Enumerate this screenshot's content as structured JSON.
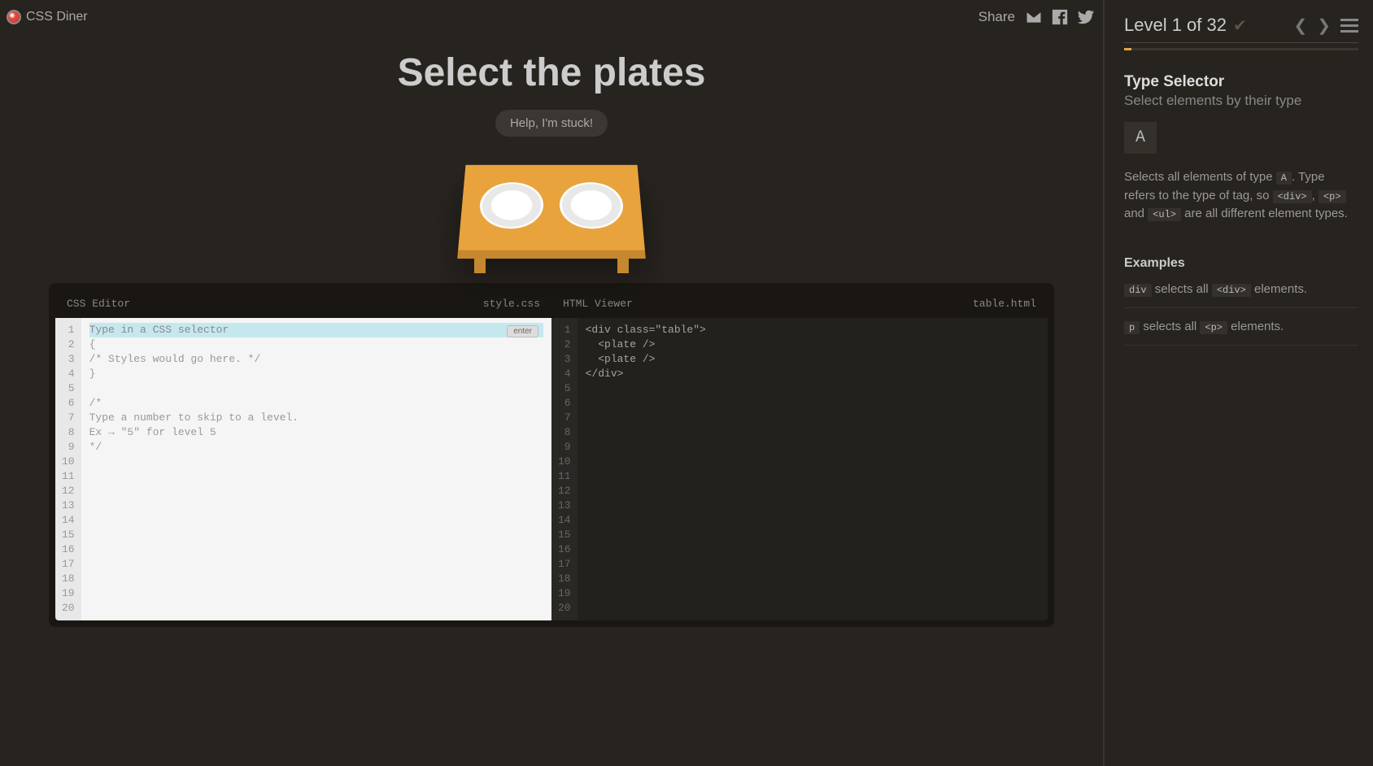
{
  "header": {
    "app_name": "CSS Diner",
    "share_label": "Share"
  },
  "title": "Select the plates",
  "help_button": "Help, I'm stuck!",
  "css_editor": {
    "title": "CSS Editor",
    "filename": "style.css",
    "placeholder": "Type in a CSS selector",
    "enter_label": "enter",
    "lines": [
      "{",
      "/* Styles would go here. */",
      "}",
      "",
      "/*",
      "Type a number to skip to a level.",
      "Ex → \"5\" for level 5",
      "*/"
    ]
  },
  "html_viewer": {
    "title": "HTML Viewer",
    "filename": "table.html",
    "lines": [
      "<div class=\"table\">",
      "  <plate />",
      "  <plate />",
      "</div>"
    ]
  },
  "line_numbers": [
    1,
    2,
    3,
    4,
    5,
    6,
    7,
    8,
    9,
    10,
    11,
    12,
    13,
    14,
    15,
    16,
    17,
    18,
    19,
    20
  ],
  "sidebar": {
    "level_label": "Level 1 of 32",
    "selector_name": "Type Selector",
    "selector_sub": "Select elements by their type",
    "syntax": "A",
    "desc_1": "Selects all elements of type ",
    "desc_chip_1": "A",
    "desc_2": ". Type refers to the type of tag, so ",
    "desc_chip_2": "<div>",
    "desc_3": ", ",
    "desc_chip_3": "<p>",
    "desc_4": " and ",
    "desc_chip_4": "<ul>",
    "desc_5": " are all different element types.",
    "examples_title": "Examples",
    "ex1_chip1": "div",
    "ex1_text": " selects all ",
    "ex1_chip2": "<div>",
    "ex1_tail": " elements.",
    "ex2_chip1": "p",
    "ex2_text": " selects all ",
    "ex2_chip2": "<p>",
    "ex2_tail": " elements."
  }
}
